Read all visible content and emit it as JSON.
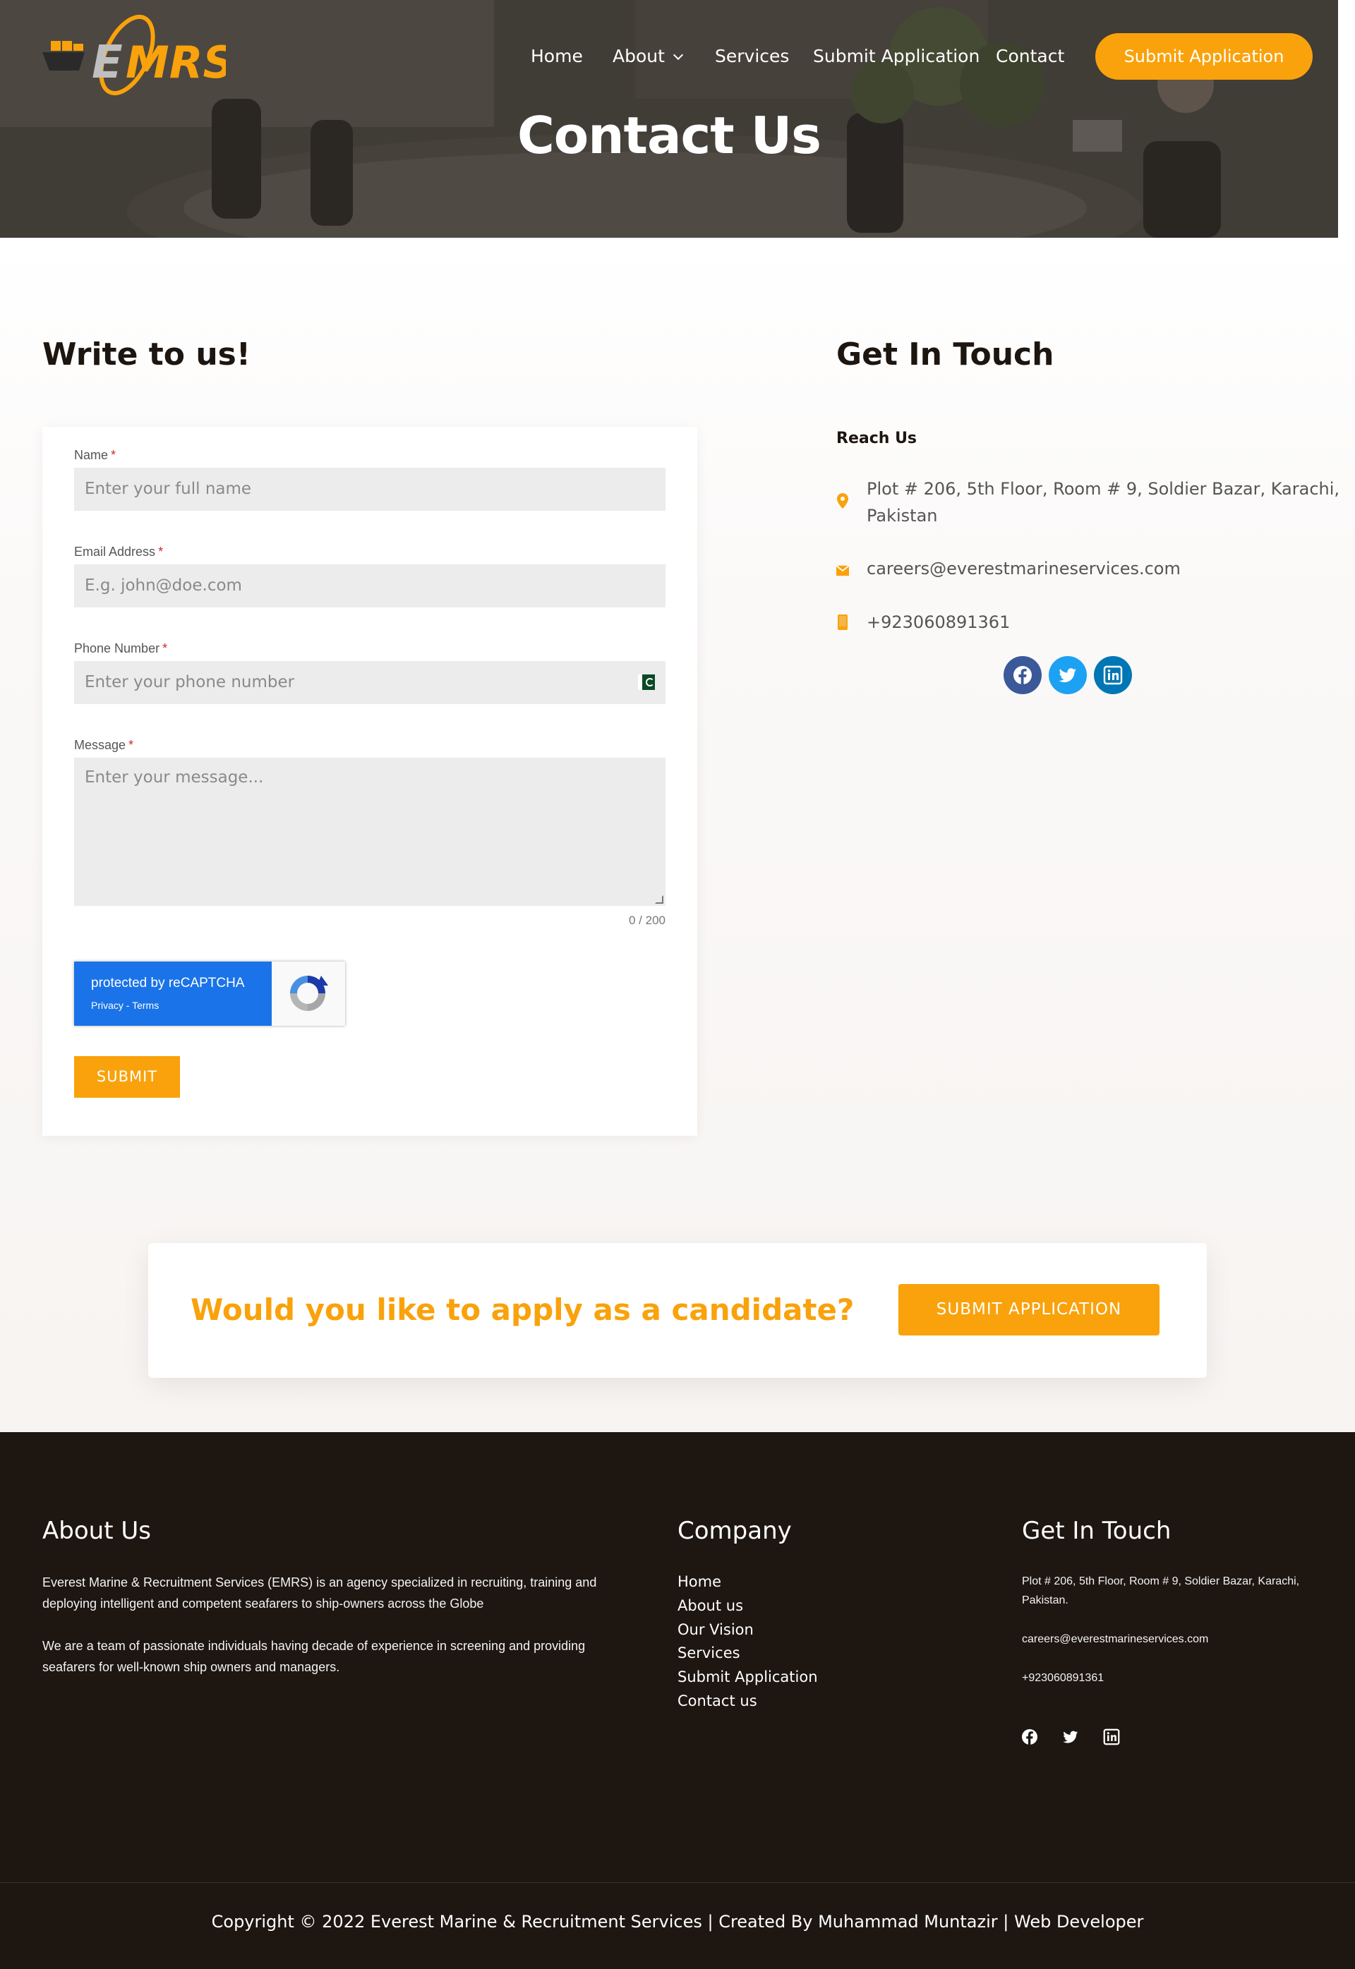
{
  "brand": {
    "logo_text": "EMRS",
    "accent": "#f9a20b",
    "dark": "#1d1611"
  },
  "nav": {
    "home": "Home",
    "about": "About",
    "services": "Services",
    "submit": "Submit Application",
    "contact": "Contact",
    "cta": "Submit Application"
  },
  "hero": {
    "title": "Contact Us"
  },
  "form_section": {
    "heading": "Write to us!",
    "name_label": "Name",
    "name_placeholder": "Enter your full name",
    "email_label": "Email Address",
    "email_placeholder": "E.g. john@doe.com",
    "phone_label": "Phone Number",
    "phone_placeholder": "Enter your phone number",
    "message_label": "Message",
    "message_placeholder": "Enter your message...",
    "required_mark": "*",
    "counter": "0 / 200",
    "recaptcha_title": "protected by reCAPTCHA",
    "recaptcha_links": "Privacy - Terms",
    "submit": "SUBMIT"
  },
  "contact_section": {
    "heading": "Get In Touch",
    "reach_label": "Reach Us",
    "address_line1": "Plot # 206, 5th Floor, Room # 9, Soldier Bazar, Karachi,",
    "address_line2": "Pakistan",
    "email": "careers@everestmarineservices.com",
    "phone": "+923060891361",
    "social": [
      "facebook-icon",
      "twitter-icon",
      "linkedin-icon"
    ],
    "social_colors": {
      "facebook": "#3b5998",
      "twitter": "#1da1f2",
      "linkedin": "#0077b5"
    }
  },
  "cta": {
    "text": "Would you like to apply as a candidate?",
    "button": "SUBMIT APPLICATION"
  },
  "footer": {
    "about_heading": "About Us",
    "about_p1": "Everest Marine & Recruitment Services (EMRS) is an agency specialized in recruiting, training and deploying intelligent and competent seafarers to ship-owners across the Globe",
    "about_p2": "We are a team of passionate individuals having decade of experience in screening and providing seafarers for well-known ship owners and managers.",
    "company_heading": "Company",
    "company_links": [
      "Home",
      "About us",
      "Our Vision",
      "Services",
      "Submit Application",
      "Contact us"
    ],
    "touch_heading": "Get In Touch",
    "touch_address": "Plot # 206, 5th Floor, Room # 9, Soldier Bazar, Karachi, Pakistan.",
    "touch_email": "careers@everestmarineservices.com",
    "touch_phone": "+923060891361",
    "copyright": "Copyright © 2022 Everest Marine & Recruitment Services | Created By Muhammad Muntazir | Web Developer"
  }
}
